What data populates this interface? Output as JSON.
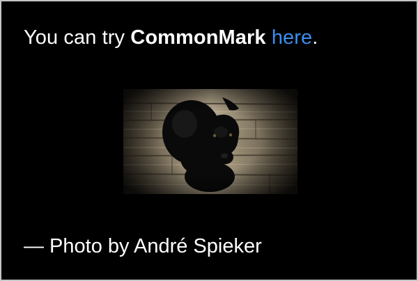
{
  "intro": {
    "prefix": "You can try ",
    "bold": "CommonMark",
    "middle": " ",
    "link": "here",
    "suffix": "."
  },
  "photo": {
    "subject": "black puppy on wooden floor"
  },
  "credit": {
    "text": "— Photo by André Spieker"
  },
  "colors": {
    "background": "#000000",
    "text": "#ffffff",
    "link": "#3b8ef0",
    "border": "#c6c6c6"
  }
}
